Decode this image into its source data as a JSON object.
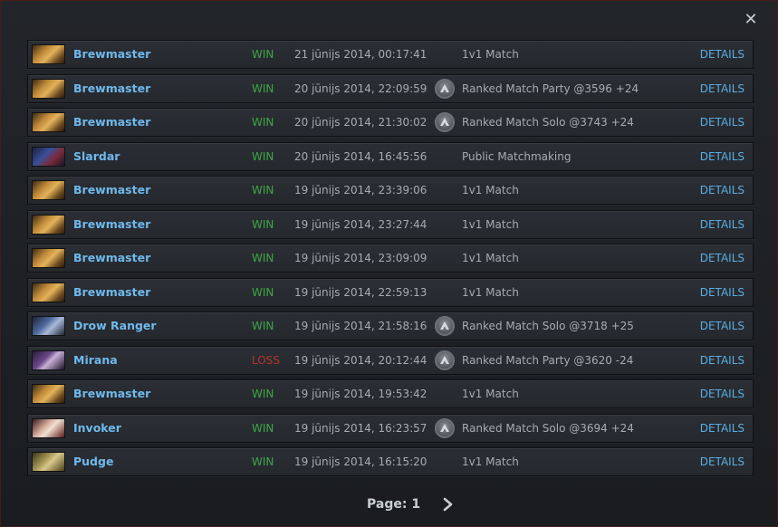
{
  "close_icon": "close-icon",
  "colors": {
    "win": "#3fa645",
    "loss": "#b4352c",
    "hero": "#6fb9ec",
    "details": "#5aaee2"
  },
  "matches": [
    {
      "hero": "Brewmaster",
      "portrait": "brewmaster",
      "result": "WIN",
      "date": "21 jūnijs 2014, 00:17:41",
      "mode": "1v1 Match",
      "ranked": false,
      "details": "DETAILS"
    },
    {
      "hero": "Brewmaster",
      "portrait": "brewmaster",
      "result": "WIN",
      "date": "20 jūnijs 2014, 22:09:59",
      "mode": "Ranked Match Party @3596 +24",
      "ranked": true,
      "details": "DETAILS"
    },
    {
      "hero": "Brewmaster",
      "portrait": "brewmaster",
      "result": "WIN",
      "date": "20 jūnijs 2014, 21:30:02",
      "mode": "Ranked Match Solo @3743 +24",
      "ranked": true,
      "details": "DETAILS"
    },
    {
      "hero": "Slardar",
      "portrait": "slardar",
      "result": "WIN",
      "date": "20 jūnijs 2014, 16:45:56",
      "mode": "Public Matchmaking",
      "ranked": false,
      "details": "DETAILS"
    },
    {
      "hero": "Brewmaster",
      "portrait": "brewmaster",
      "result": "WIN",
      "date": "19 jūnijs 2014, 23:39:06",
      "mode": "1v1 Match",
      "ranked": false,
      "details": "DETAILS"
    },
    {
      "hero": "Brewmaster",
      "portrait": "brewmaster",
      "result": "WIN",
      "date": "19 jūnijs 2014, 23:27:44",
      "mode": "1v1 Match",
      "ranked": false,
      "details": "DETAILS"
    },
    {
      "hero": "Brewmaster",
      "portrait": "brewmaster",
      "result": "WIN",
      "date": "19 jūnijs 2014, 23:09:09",
      "mode": "1v1 Match",
      "ranked": false,
      "details": "DETAILS"
    },
    {
      "hero": "Brewmaster",
      "portrait": "brewmaster",
      "result": "WIN",
      "date": "19 jūnijs 2014, 22:59:13",
      "mode": "1v1 Match",
      "ranked": false,
      "details": "DETAILS"
    },
    {
      "hero": "Drow Ranger",
      "portrait": "drow",
      "result": "WIN",
      "date": "19 jūnijs 2014, 21:58:16",
      "mode": "Ranked Match Solo @3718 +25",
      "ranked": true,
      "details": "DETAILS"
    },
    {
      "hero": "Mirana",
      "portrait": "mirana",
      "result": "LOSS",
      "date": "19 jūnijs 2014, 20:12:44",
      "mode": "Ranked Match Party @3620 -24",
      "ranked": true,
      "details": "DETAILS"
    },
    {
      "hero": "Brewmaster",
      "portrait": "brewmaster",
      "result": "WIN",
      "date": "19 jūnijs 2014, 19:53:42",
      "mode": "1v1 Match",
      "ranked": false,
      "details": "DETAILS"
    },
    {
      "hero": "Invoker",
      "portrait": "invoker",
      "result": "WIN",
      "date": "19 jūnijs 2014, 16:23:57",
      "mode": "Ranked Match Solo @3694 +24",
      "ranked": true,
      "details": "DETAILS"
    },
    {
      "hero": "Pudge",
      "portrait": "pudge",
      "result": "WIN",
      "date": "19 jūnijs 2014, 16:15:20",
      "mode": "1v1 Match",
      "ranked": false,
      "details": "DETAILS"
    }
  ],
  "pager": {
    "label": "Page: 1",
    "next_icon": "chevron-right-icon"
  }
}
